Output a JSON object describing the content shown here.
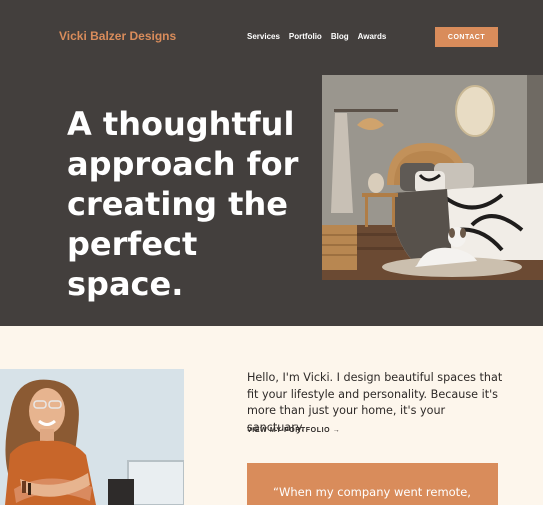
{
  "brand": "Vicki Balzer Designs",
  "nav": {
    "items": [
      "Services",
      "Portfolio",
      "Blog",
      "Awards"
    ],
    "contact_label": "CONTACT"
  },
  "hero": {
    "headline": "A thoughtful approach for creating the perfect space.",
    "image": "bedroom-interior-photo"
  },
  "about": {
    "image": "vicki-portrait-photo",
    "intro": "Hello, I'm Vicki. I design beautiful spaces that fit your lifestyle and personality. Because it's more than just your home, it's your sanctuary.",
    "portfolio_link": "VIEW MY PORTFOLIO →"
  },
  "testimonial": {
    "quote": "“When my company went remote,"
  },
  "colors": {
    "hero_bg": "#433f3d",
    "accent": "#d98c5b",
    "page_bg": "#fdf6ec",
    "text_dark": "#2e2a28"
  }
}
